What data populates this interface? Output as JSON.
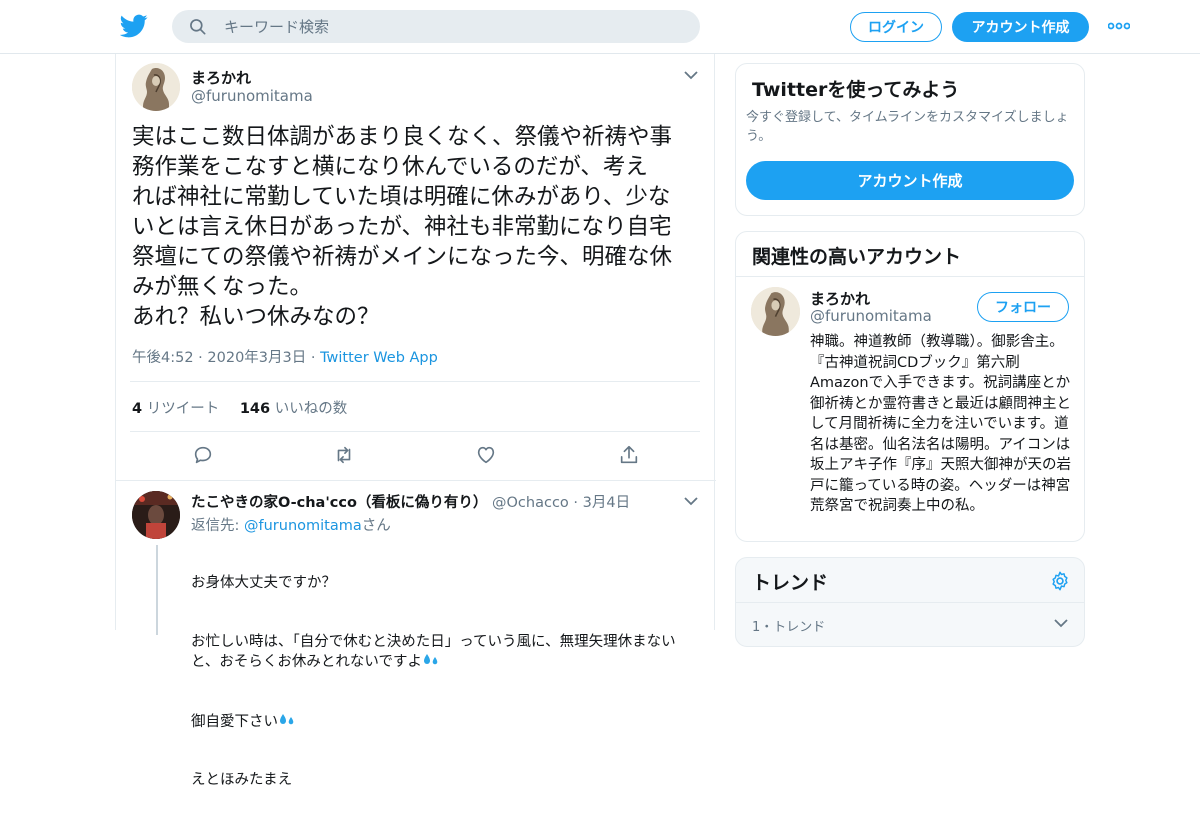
{
  "header": {
    "search_placeholder": "キーワード検索",
    "login_label": "ログイン",
    "signup_label": "アカウント作成"
  },
  "tweet": {
    "author_name": "まろかれ",
    "author_handle": "@furunomitama",
    "text": "実はここ数日体調があまり良くなく、祭儀や祈祷や事\n務作業をこなすと横になり休んでいるのだが、考え\nれば神社に常勤していた頃は明確に休みがあり、少な\nいとは言え休日があったが、神社も非常勤になり自宅\n祭壇にての祭儀や祈祷がメインになった今、明確な休\nみが無くなった。\nあれ？私いつ休みなの？",
    "timestamp": "午後4:52 · 2020年3月3日 · ",
    "source": "Twitter Web App",
    "retweet_count": "4",
    "retweet_label": "リツイート",
    "like_count": "146",
    "like_label": "いいねの数"
  },
  "reply": {
    "author_name": "たこやきの家O-cha'cco（看板に偽り有り）",
    "author_handle": "@Ochacco",
    "time": "· 3月4日",
    "reply_to_prefix": "返信先: ",
    "reply_to_handle": "@furunomitama",
    "reply_to_suffix": "さん",
    "line1": "お身体大丈夫ですか？",
    "line2": "お忙しい時は、「自分で休むと決めた日」っていう風に、無理矢理休まないと、おそらくお休みとれないですよ",
    "line3": "御自愛下さい",
    "line4": "えとほみたまえ"
  },
  "sidebar": {
    "try_title": "Twitterを使ってみよう",
    "try_subtitle": "今すぐ登録して、タイムラインをカスタマイズしましょう。",
    "try_button": "アカウント作成",
    "related_title": "関連性の高いアカウント",
    "related_name": "まろかれ",
    "related_handle": "@furunomitama",
    "follow_label": "フォロー",
    "related_bio": "神職。神道教師（教導職）。御影舎主。『古神道祝詞CDブック』第六刷Amazonで入手できます。祝詞講座とか御祈祷とか霊符書きと最近は顧問神主として月間祈祷に全力を注いでいます。道名は基密。仙名法名は陽明。アイコンは坂上アキ子作『序』天照大御神が天の岩戸に籠っている時の姿。ヘッダーは神宮荒祭宮で祝詞奏上中の私。",
    "trends_title": "トレンド",
    "trend_item": "1・トレンド"
  },
  "colors": {
    "accent": "#1da1f2",
    "link": "#1b95e0",
    "muted": "#657786"
  },
  "icons": [
    "twitter-bird-icon",
    "search-icon",
    "more-dots-icon",
    "chevron-down-icon",
    "reply-icon",
    "retweet-icon",
    "like-icon",
    "share-icon",
    "gear-icon",
    "sweat-drops-icon"
  ]
}
